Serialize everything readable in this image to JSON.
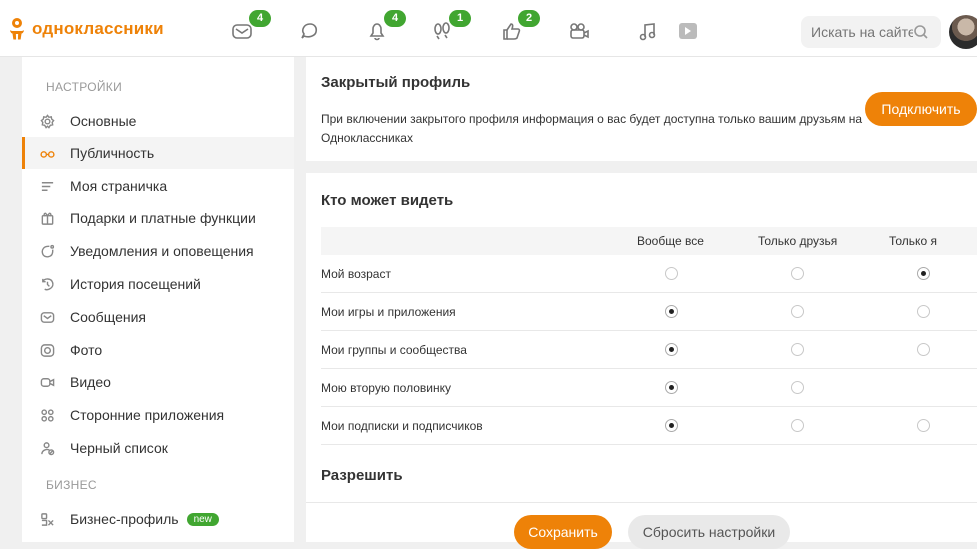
{
  "header": {
    "logo": "одноклассники",
    "badges": {
      "messages": "4",
      "notifications": "4",
      "guests": "1",
      "likes": "2"
    },
    "search_placeholder": "Искать на сайте"
  },
  "sidebar": {
    "settings_title": "НАСТРОЙКИ",
    "items": [
      {
        "label": "Основные",
        "icon": "gear-icon"
      },
      {
        "label": "Публичность",
        "icon": "glasses-icon"
      },
      {
        "label": "Моя страничка",
        "icon": "lines-icon"
      },
      {
        "label": "Подарки и платные функции",
        "icon": "gift-icon"
      },
      {
        "label": "Уведомления и оповещения",
        "icon": "notification-icon"
      },
      {
        "label": "История посещений",
        "icon": "history-icon"
      },
      {
        "label": "Сообщения",
        "icon": "message-icon"
      },
      {
        "label": "Фото",
        "icon": "camera-icon"
      },
      {
        "label": "Видео",
        "icon": "video-icon"
      },
      {
        "label": "Сторонние приложения",
        "icon": "apps-icon"
      },
      {
        "label": "Черный список",
        "icon": "blacklist-icon"
      }
    ],
    "business_title": "БИЗНЕС",
    "business_item": "Бизнес-профиль",
    "business_badge": "new"
  },
  "closed_profile": {
    "title": "Закрытый профиль",
    "description": "При включении закрытого профиля информация о вас будет доступна только вашим друзьям на Одноклассниках",
    "button": "Подключить"
  },
  "visibility": {
    "title": "Кто может видеть",
    "columns": [
      "Вообще все",
      "Только друзья",
      "Только я"
    ],
    "rows": [
      {
        "label": "Мой возраст",
        "selected": 2,
        "options": 3
      },
      {
        "label": "Мои игры и приложения",
        "selected": 0,
        "options": 3
      },
      {
        "label": "Мои группы и сообщества",
        "selected": 0,
        "options": 3
      },
      {
        "label": "Мою вторую половинку",
        "selected": 0,
        "options": 2
      },
      {
        "label": "Мои подписки и подписчиков",
        "selected": 0,
        "options": 3
      }
    ]
  },
  "allow": {
    "title": "Разрешить"
  },
  "footer": {
    "save": "Сохранить",
    "reset": "Сбросить настройки"
  },
  "colors": {
    "accent": "#ee8208",
    "badge": "#41a631"
  }
}
